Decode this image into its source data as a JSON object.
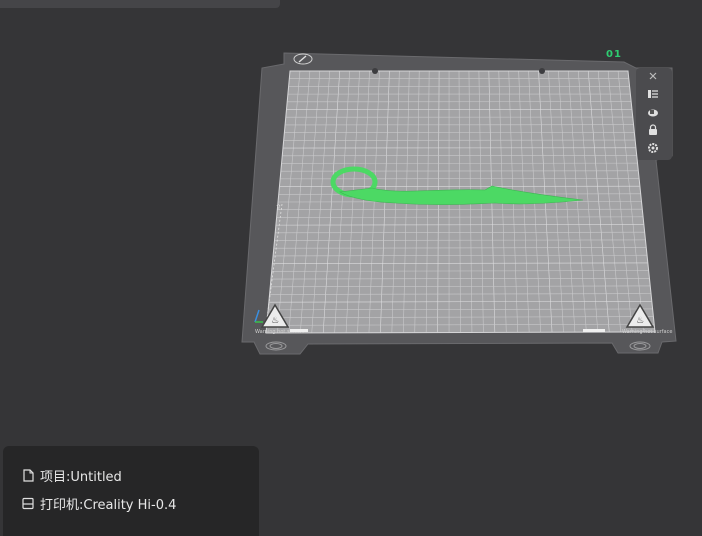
{
  "plate": {
    "number": "01",
    "warning_left": "Warning hot surface",
    "warning_right": "Warning hot surface",
    "model_color": "#4cd964",
    "plate_color": "#5a5a5d",
    "grid_bg": "#9a9a9c"
  },
  "plate_toolbar": {
    "items": [
      {
        "name": "close-icon"
      },
      {
        "name": "list-icon"
      },
      {
        "name": "auto-orient-icon"
      },
      {
        "name": "lock-icon"
      },
      {
        "name": "settings-icon"
      }
    ]
  },
  "info": {
    "project_label": "项目:Untitled",
    "printer_label": "打印机:Creality Hi-0.4"
  },
  "colors": {
    "background": "#353537",
    "panel": "#262627",
    "accent": "#2ecc71"
  }
}
